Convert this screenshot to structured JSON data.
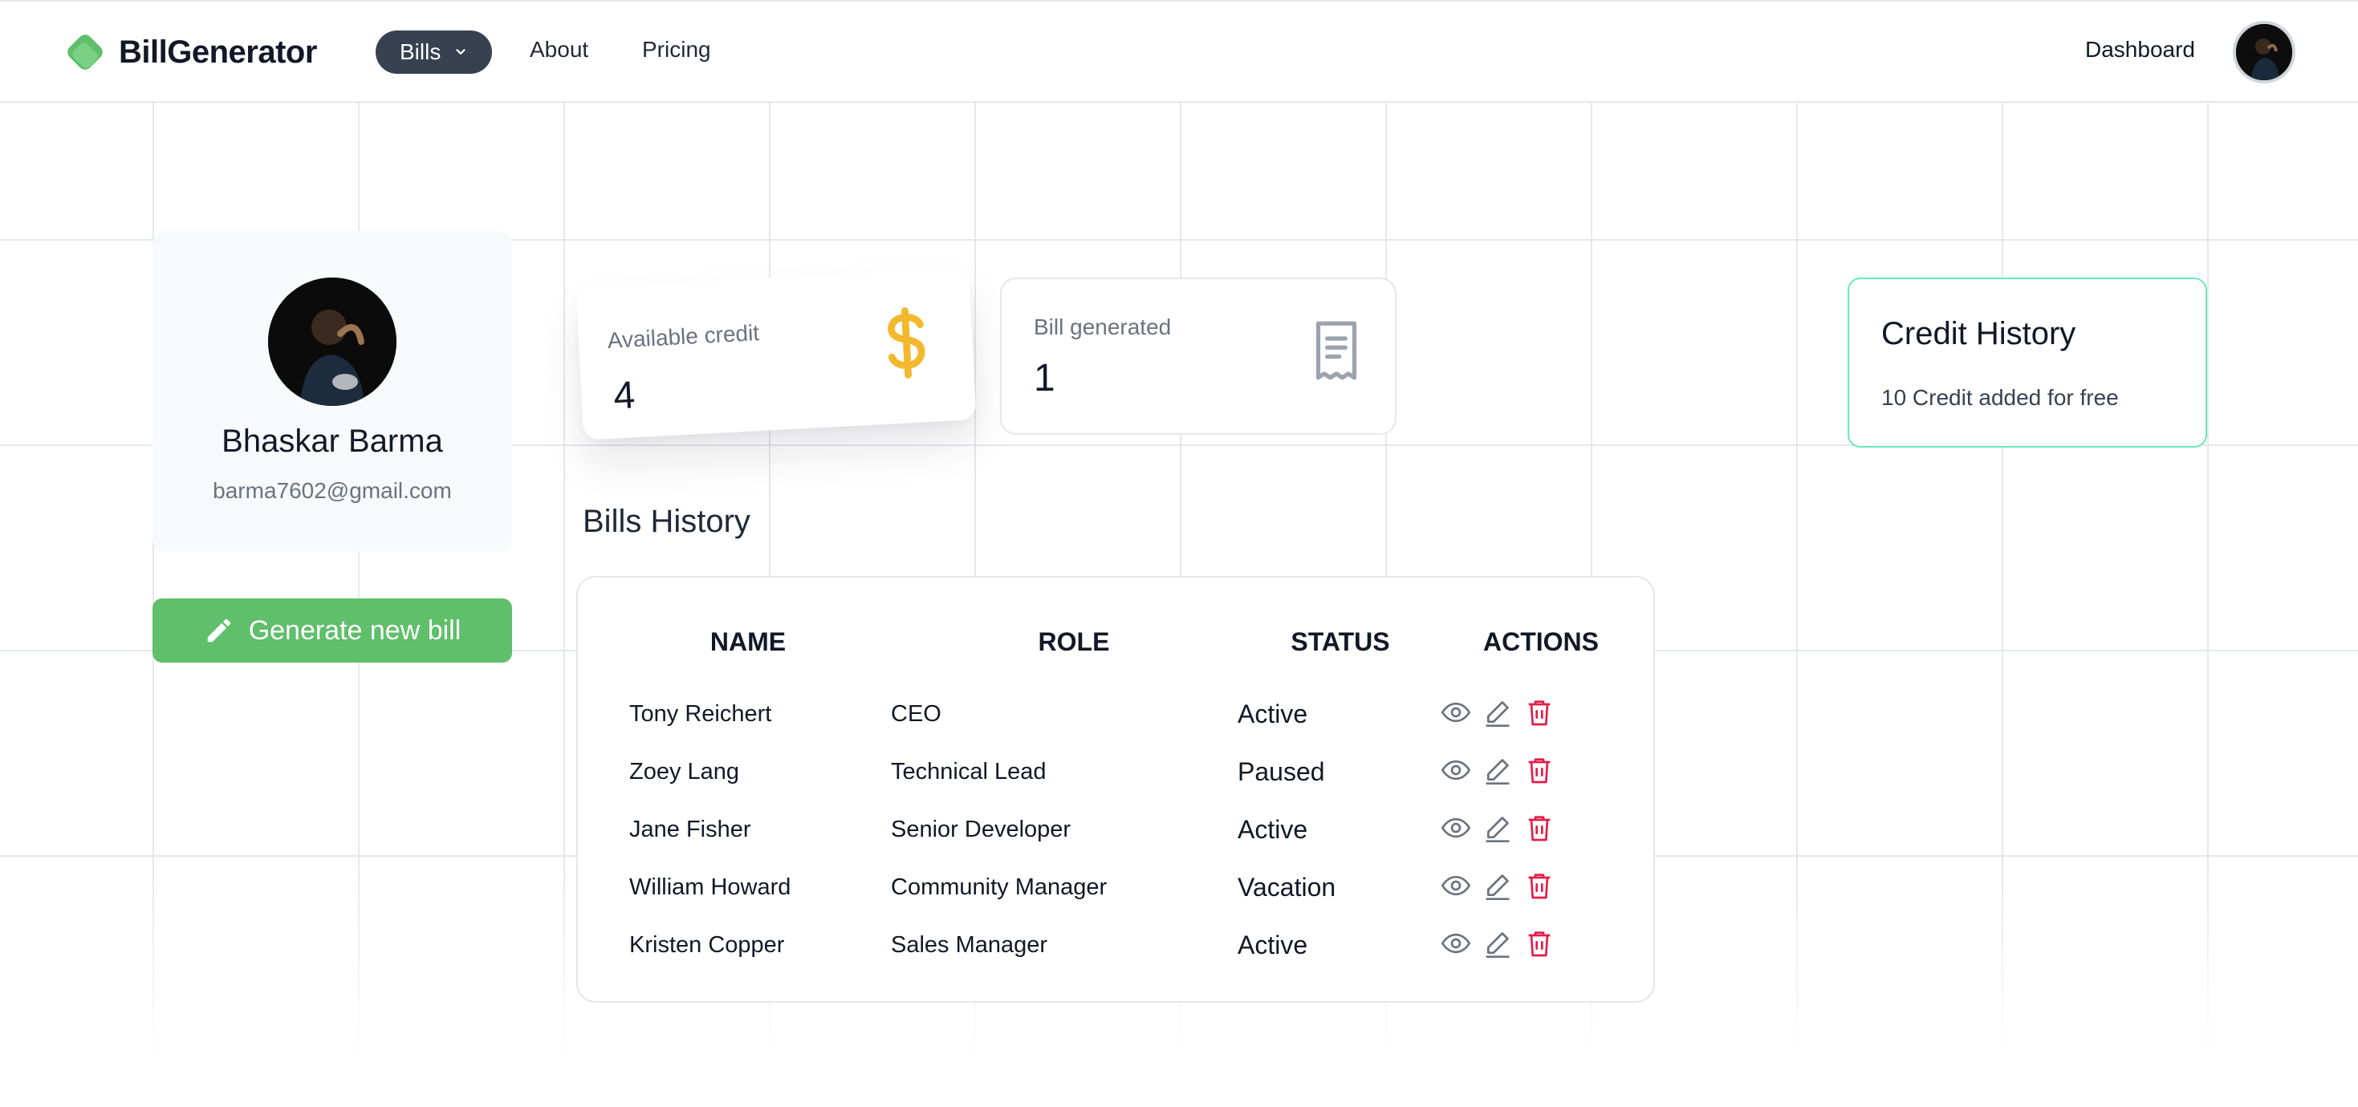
{
  "brand": {
    "name": "BillGenerator",
    "accent_color": "#5fbf6a",
    "logo_icon": "green-diamond-logo-icon"
  },
  "nav": {
    "bills_label": "Bills",
    "about_label": "About",
    "pricing_label": "Pricing",
    "dashboard_label": "Dashboard"
  },
  "profile": {
    "name": "Bhaskar Barma",
    "email": "barma7602@gmail.com",
    "generate_button_label": "Generate new bill"
  },
  "stats": {
    "credit_label": "Available credit",
    "credit_value": "4",
    "bill_label": "Bill generated",
    "bill_value": "1"
  },
  "credit_history": {
    "title": "Credit History",
    "entry": "10 Credit added for free"
  },
  "bills_history": {
    "title": "Bills History",
    "columns": [
      "NAME",
      "ROLE",
      "STATUS",
      "ACTIONS"
    ],
    "rows": [
      {
        "name": "Tony Reichert",
        "role": "CEO",
        "status": "Active"
      },
      {
        "name": "Zoey Lang",
        "role": "Technical Lead",
        "status": "Paused"
      },
      {
        "name": "Jane Fisher",
        "role": "Senior Developer",
        "status": "Active"
      },
      {
        "name": "William Howard",
        "role": "Community Manager",
        "status": "Vacation"
      },
      {
        "name": "Kristen Copper",
        "role": "Sales Manager",
        "status": "Active"
      }
    ],
    "action_icons": [
      "eye-icon",
      "edit-icon",
      "trash-icon"
    ],
    "delete_color": "#e11d48"
  }
}
